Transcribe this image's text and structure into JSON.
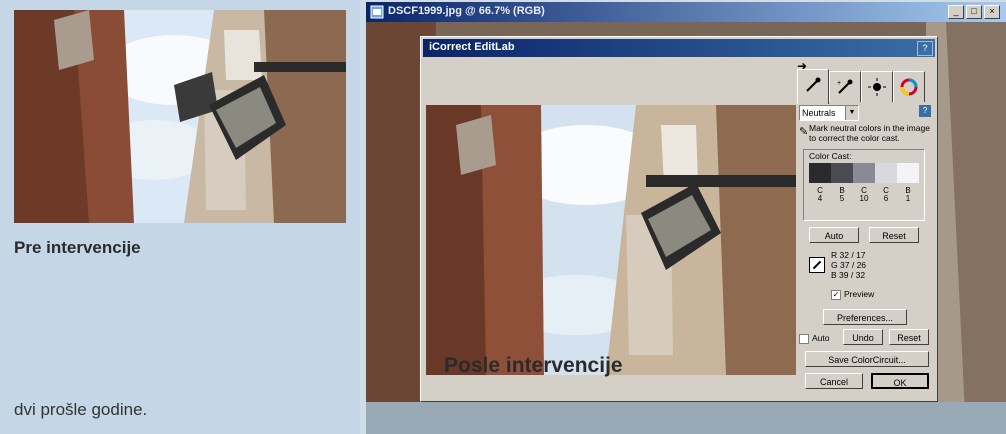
{
  "left": {
    "caption_before": "Pre intervencije",
    "body_text": "dvi prošle godine."
  },
  "photoshop": {
    "title": "DSCF1999.jpg @ 66.7% (RGB)",
    "buttons": [
      "_",
      "□",
      "×"
    ]
  },
  "dialog": {
    "title": "iCorrect EditLab",
    "close": "?",
    "tabs": [
      {
        "icon": "eyedropper-icon"
      },
      {
        "icon": "eyedropper-plus-icon"
      },
      {
        "icon": "brightness-contrast-icon"
      },
      {
        "icon": "color-wheel-icon"
      }
    ],
    "select_value": "Neutrals",
    "instruction": "Mark neutral colors in the image to correct the color cast.",
    "color_cast_label": "Color Cast:",
    "swatch_colors": [
      "#2a2a2e",
      "#4a4a52",
      "#8a8a96",
      "#d8d8de",
      "#f4f4f6"
    ],
    "cast_values": [
      {
        "letter": "C",
        "num": "4"
      },
      {
        "letter": "B",
        "num": "5"
      },
      {
        "letter": "C",
        "num": "10"
      },
      {
        "letter": "C",
        "num": "6"
      },
      {
        "letter": "B",
        "num": "1"
      }
    ],
    "auto_label": "Auto",
    "reset_label": "Reset",
    "rgb": [
      {
        "ch": "R",
        "a": "32",
        "b": "17"
      },
      {
        "ch": "G",
        "a": "37",
        "b": "26"
      },
      {
        "ch": "B",
        "a": "39",
        "b": "32"
      }
    ],
    "preview_label": "Preview",
    "preferences_label": "Preferences...",
    "auto_check_label": "Auto",
    "undo_label": "Undo",
    "reset2_label": "Reset",
    "save_label": "Save ColorCircuit...",
    "cancel_label": "Cancel",
    "ok_label": "OK"
  },
  "caption_after": "Posle intervencije"
}
